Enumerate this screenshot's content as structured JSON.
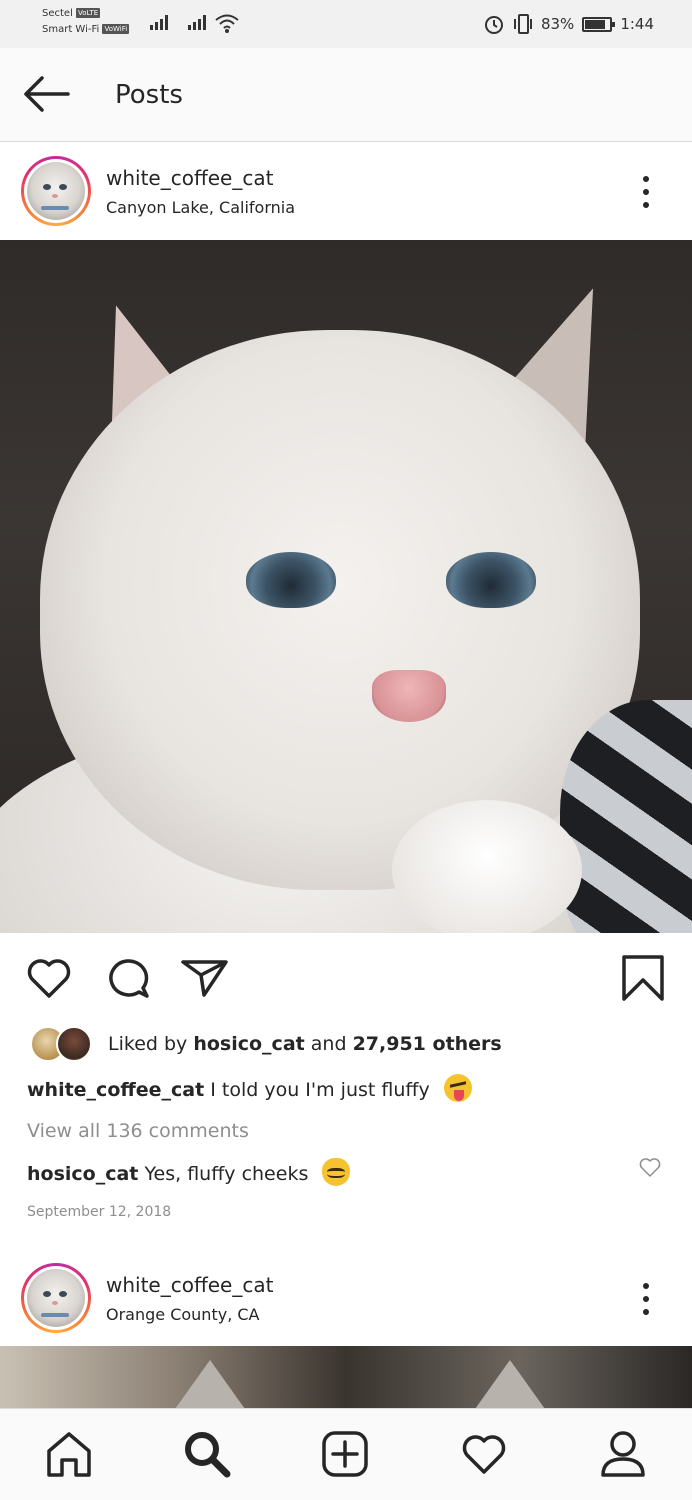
{
  "status_bar": {
    "carrier_1": "Sectel",
    "carrier_1_tag": "VoLTE",
    "carrier_2": "Smart Wi-Fi",
    "carrier_2_tag": "VoWiFi",
    "battery_percent": "83%",
    "battery_level": 0.83,
    "time": "1:44"
  },
  "header": {
    "title": "Posts"
  },
  "posts": [
    {
      "username": "white_coffee_cat",
      "location": "Canyon Lake, California",
      "likes": {
        "prefix": "Liked by",
        "liker": "hosico_cat",
        "joiner": "and",
        "others": "27,951 others"
      },
      "caption": {
        "username": "white_coffee_cat",
        "text": "I told you I'm just fluffy"
      },
      "view_all_comments": "View all 136 comments",
      "comment": {
        "username": "hosico_cat",
        "text": "Yes, fluffy cheeks"
      },
      "date": "September 12, 2018"
    },
    {
      "username": "white_coffee_cat",
      "location": "Orange County, CA"
    }
  ],
  "icons": {
    "back": "arrow-left-icon",
    "more": "more-vertical-icon",
    "like": "heart-icon",
    "comment": "comment-bubble-icon",
    "share": "paper-plane-icon",
    "save": "bookmark-icon",
    "home": "home-icon",
    "search": "search-icon",
    "add": "plus-square-icon",
    "activity": "heart-icon",
    "profile": "profile-icon"
  },
  "colors": {
    "text": "#262626",
    "muted": "#8e8e8e",
    "story_ring_start": "#c32aa3",
    "story_ring_end": "#fcaf45",
    "header_bg": "#fafafa"
  }
}
